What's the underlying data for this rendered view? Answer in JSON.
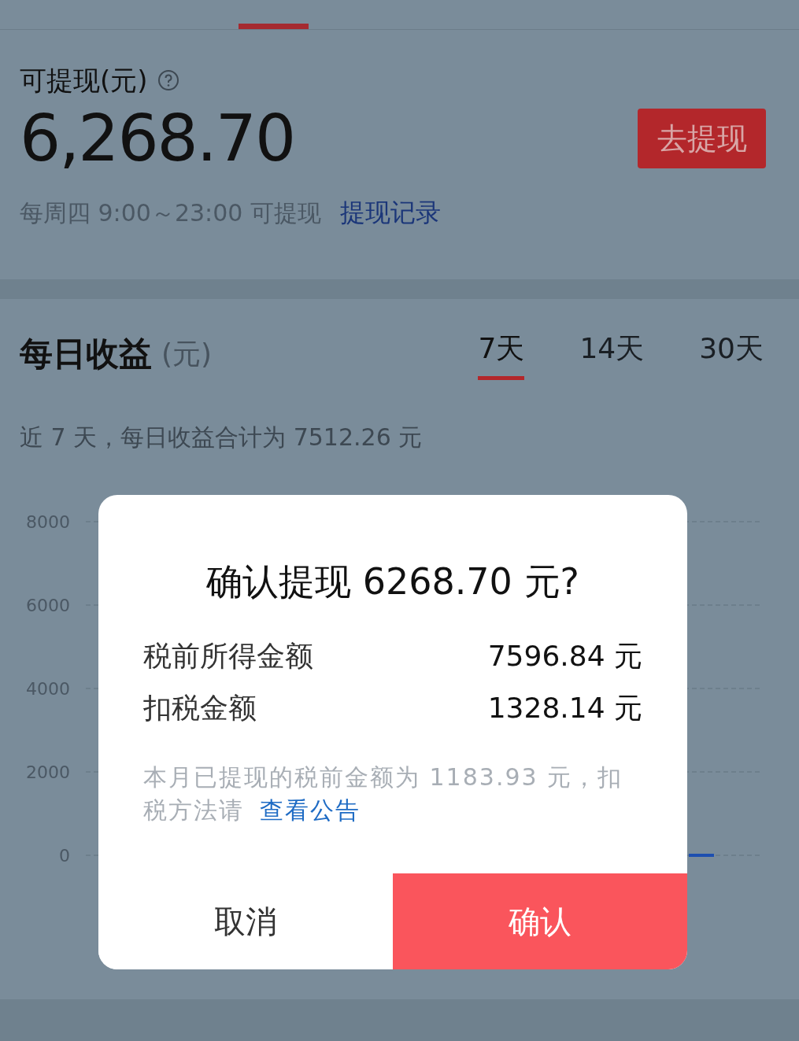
{
  "balance": {
    "label": "可提现(元)",
    "amount": "6,268.70",
    "withdraw_button": "去提现",
    "schedule": "每周四 9:00～23:00 可提现",
    "history_link": "提现记录"
  },
  "earnings": {
    "title": "每日收益",
    "unit": "(元)",
    "tabs": [
      {
        "label": "7天",
        "selected": true
      },
      {
        "label": "14天",
        "selected": false
      },
      {
        "label": "30天",
        "selected": false
      }
    ],
    "summary": "近 7 天，每日收益合计为 7512.26 元",
    "chart": {
      "y_labels": [
        "8000",
        "6000",
        "4000",
        "2000",
        "0"
      ]
    }
  },
  "dialog": {
    "title": "确认提现 6268.70 元?",
    "rows": [
      {
        "label": "税前所得金额",
        "value": "7596.84 元"
      },
      {
        "label": "扣税金额",
        "value": "1328.14 元"
      }
    ],
    "note": "本月已提现的税前金额为 1183.93 元，扣税方法请",
    "note_link": "查看公告",
    "buttons": [
      {
        "label": "取消",
        "kind": "cancel"
      },
      {
        "label": "确认",
        "kind": "confirm"
      }
    ]
  }
}
